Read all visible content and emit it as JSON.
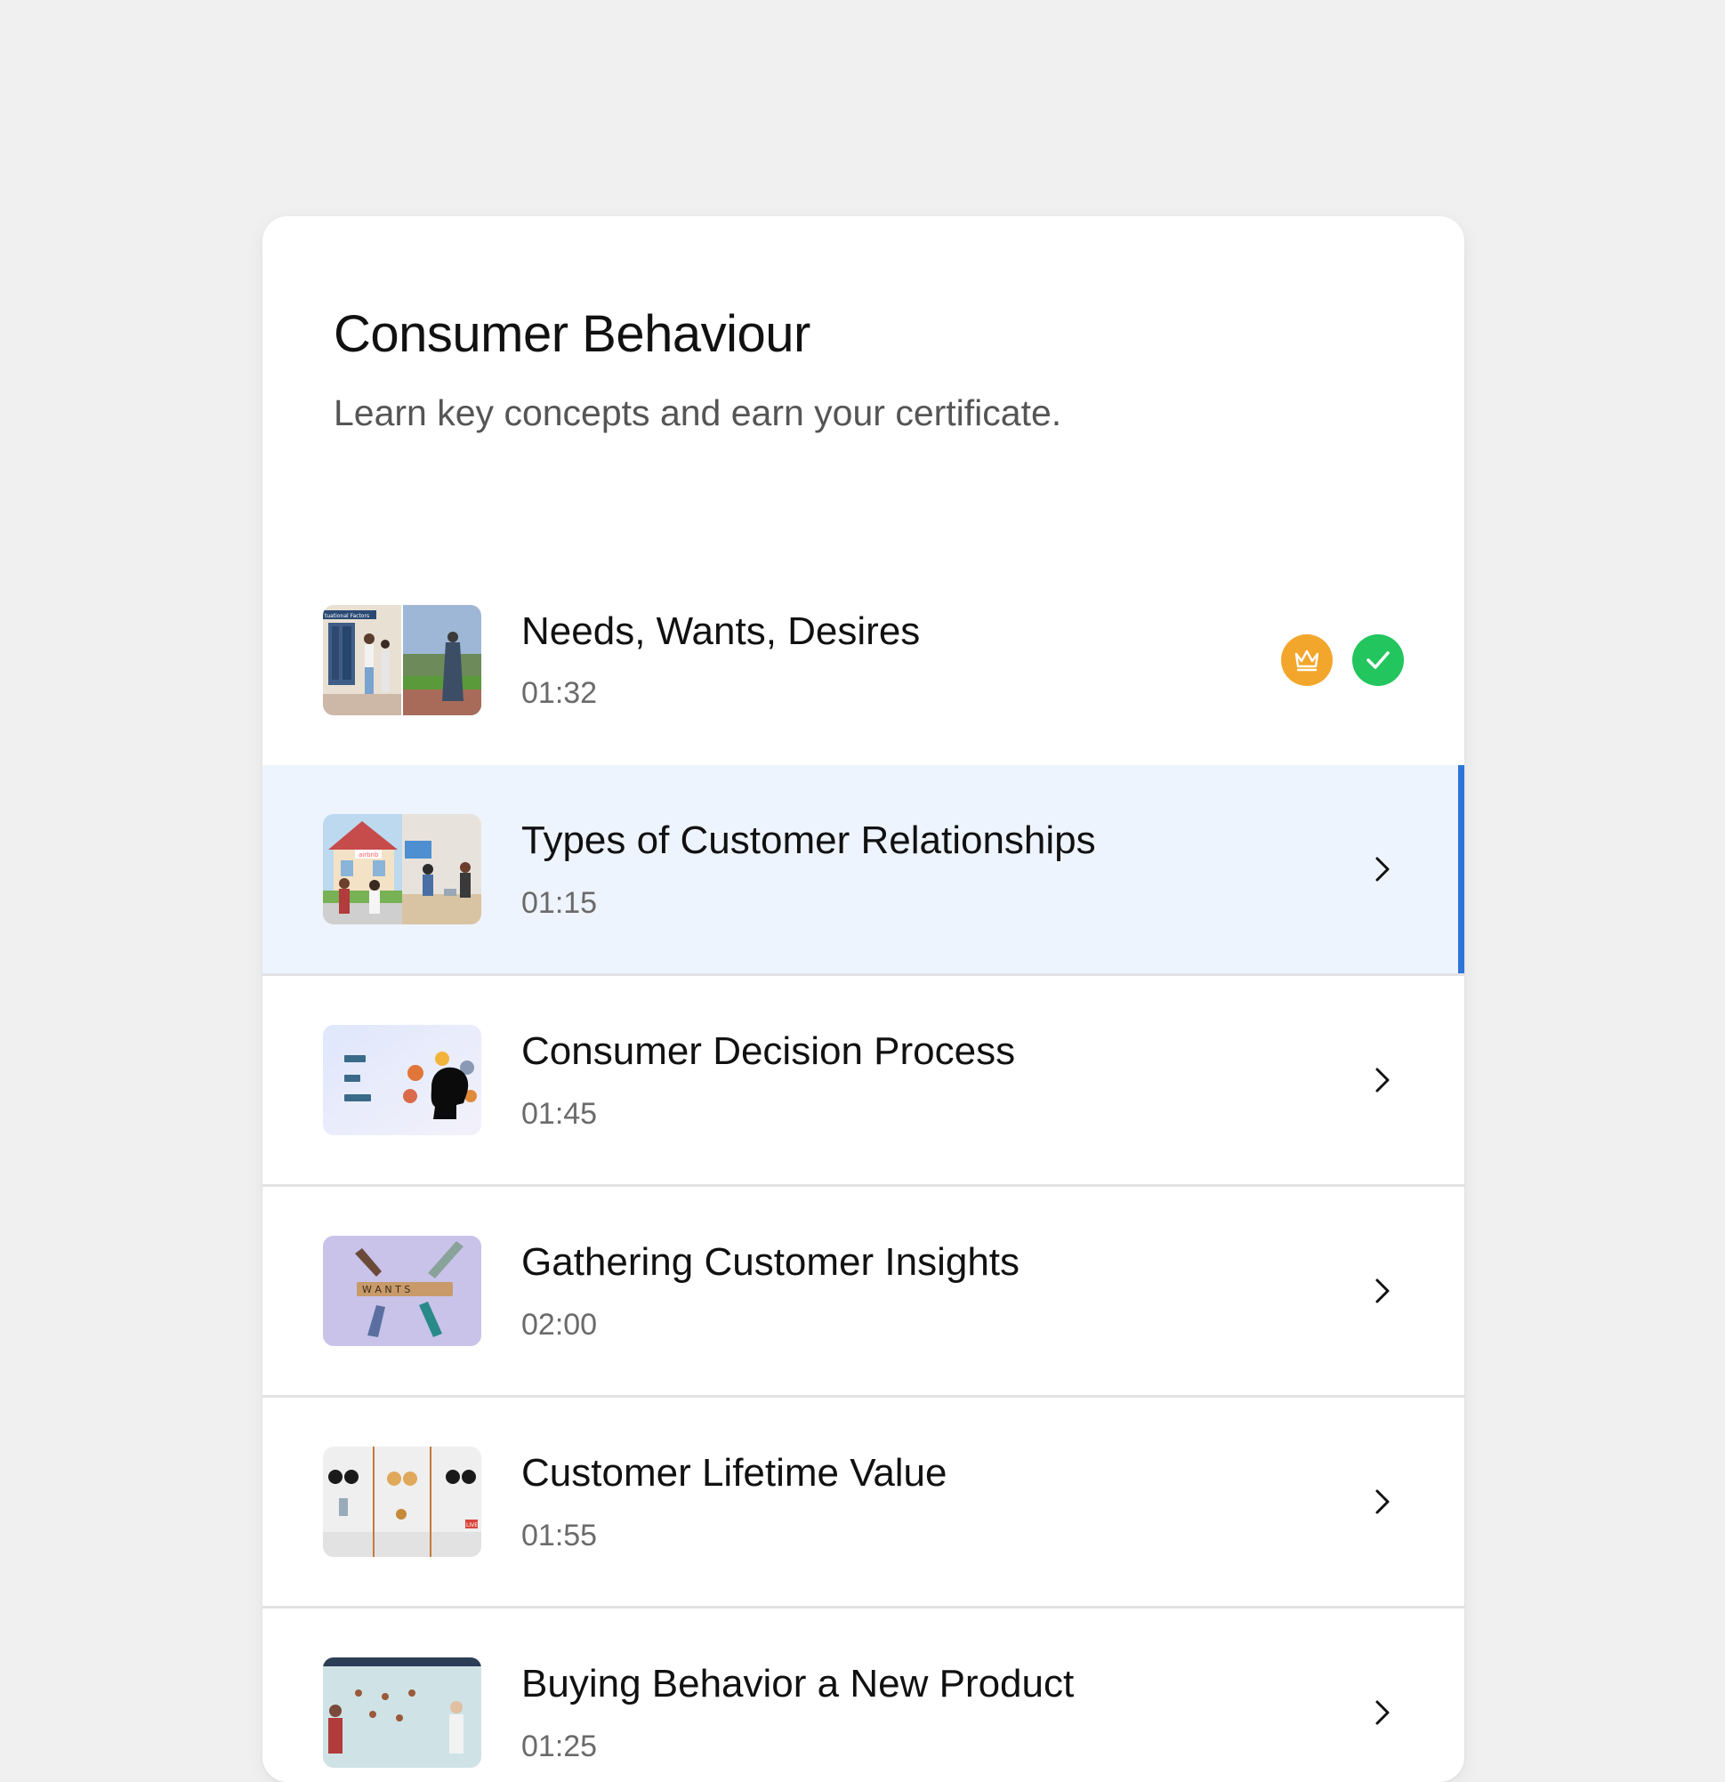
{
  "course": {
    "title": "Consumer Behaviour",
    "subtitle": "Learn key concepts and earn your certificate."
  },
  "lessons": [
    {
      "title": "Needs, Wants, Desires",
      "duration": "01:32",
      "status": "completed",
      "badges": [
        "crown-icon",
        "check-icon"
      ],
      "thumb_text": "tuational Factors"
    },
    {
      "title": "Types of Customer Relationships",
      "duration": "01:15",
      "status": "active",
      "thumb_text": "airbnb"
    },
    {
      "title": "Consumer Decision Process",
      "duration": "01:45",
      "status": "default"
    },
    {
      "title": "Gathering Customer Insights",
      "duration": "02:00",
      "status": "default",
      "thumb_text": "W A N T S"
    },
    {
      "title": "Customer Lifetime Value",
      "duration": "01:55",
      "status": "default",
      "thumb_text": "LIVE"
    },
    {
      "title": "Buying Behavior a New Product",
      "duration": "01:25",
      "status": "default"
    }
  ],
  "colors": {
    "accent": "#2f74d8",
    "active_row": "#eef4fd",
    "crown_badge": "#f3a62c",
    "check_badge": "#22c55e"
  }
}
